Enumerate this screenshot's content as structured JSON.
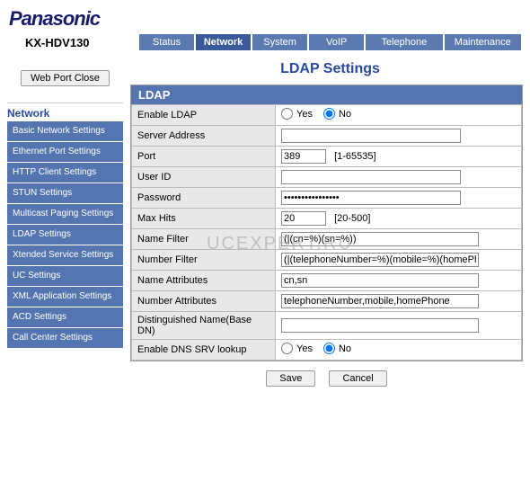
{
  "brand": "Panasonic",
  "model": "KX-HDV130",
  "tabs": [
    {
      "label": "Status"
    },
    {
      "label": "Network",
      "active": true
    },
    {
      "label": "System"
    },
    {
      "label": "VoIP"
    },
    {
      "label": "Telephone"
    },
    {
      "label": "Maintenance"
    }
  ],
  "page_title": "LDAP Settings",
  "webport_btn": "Web Port Close",
  "sidemenu": {
    "title": "Network",
    "items": [
      "Basic Network Settings",
      "Ethernet Port Settings",
      "HTTP Client Settings",
      "STUN Settings",
      "Multicast Paging Settings",
      "LDAP Settings",
      "Xtended Service Settings",
      "UC Settings",
      "XML Application Settings",
      "ACD Settings",
      "Call Center Settings"
    ]
  },
  "panel_title": "LDAP",
  "form": {
    "enable_ldap": {
      "label": "Enable LDAP",
      "yes": "Yes",
      "no": "No",
      "value": "No"
    },
    "server_address": {
      "label": "Server Address",
      "value": ""
    },
    "port": {
      "label": "Port",
      "value": "389",
      "hint": "[1-65535]"
    },
    "user_id": {
      "label": "User ID",
      "value": ""
    },
    "password": {
      "label": "Password",
      "value": "••••••••••••••••"
    },
    "max_hits": {
      "label": "Max Hits",
      "value": "20",
      "hint": "[20-500]"
    },
    "name_filter": {
      "label": "Name Filter",
      "value": "(|(cn=%)(sn=%))"
    },
    "number_filter": {
      "label": "Number Filter",
      "value": "(|(telephoneNumber=%)(mobile=%)(homePhone=%"
    },
    "name_attributes": {
      "label": "Name Attributes",
      "value": "cn,sn"
    },
    "number_attributes": {
      "label": "Number Attributes",
      "value": "telephoneNumber,mobile,homePhone"
    },
    "distinguished_name": {
      "label": "Distinguished Name(Base DN)",
      "value": ""
    },
    "enable_dns_srv": {
      "label": "Enable DNS SRV lookup",
      "yes": "Yes",
      "no": "No",
      "value": "No"
    }
  },
  "actions": {
    "save": "Save",
    "cancel": "Cancel"
  },
  "watermark": "UCEXPERT.RU"
}
